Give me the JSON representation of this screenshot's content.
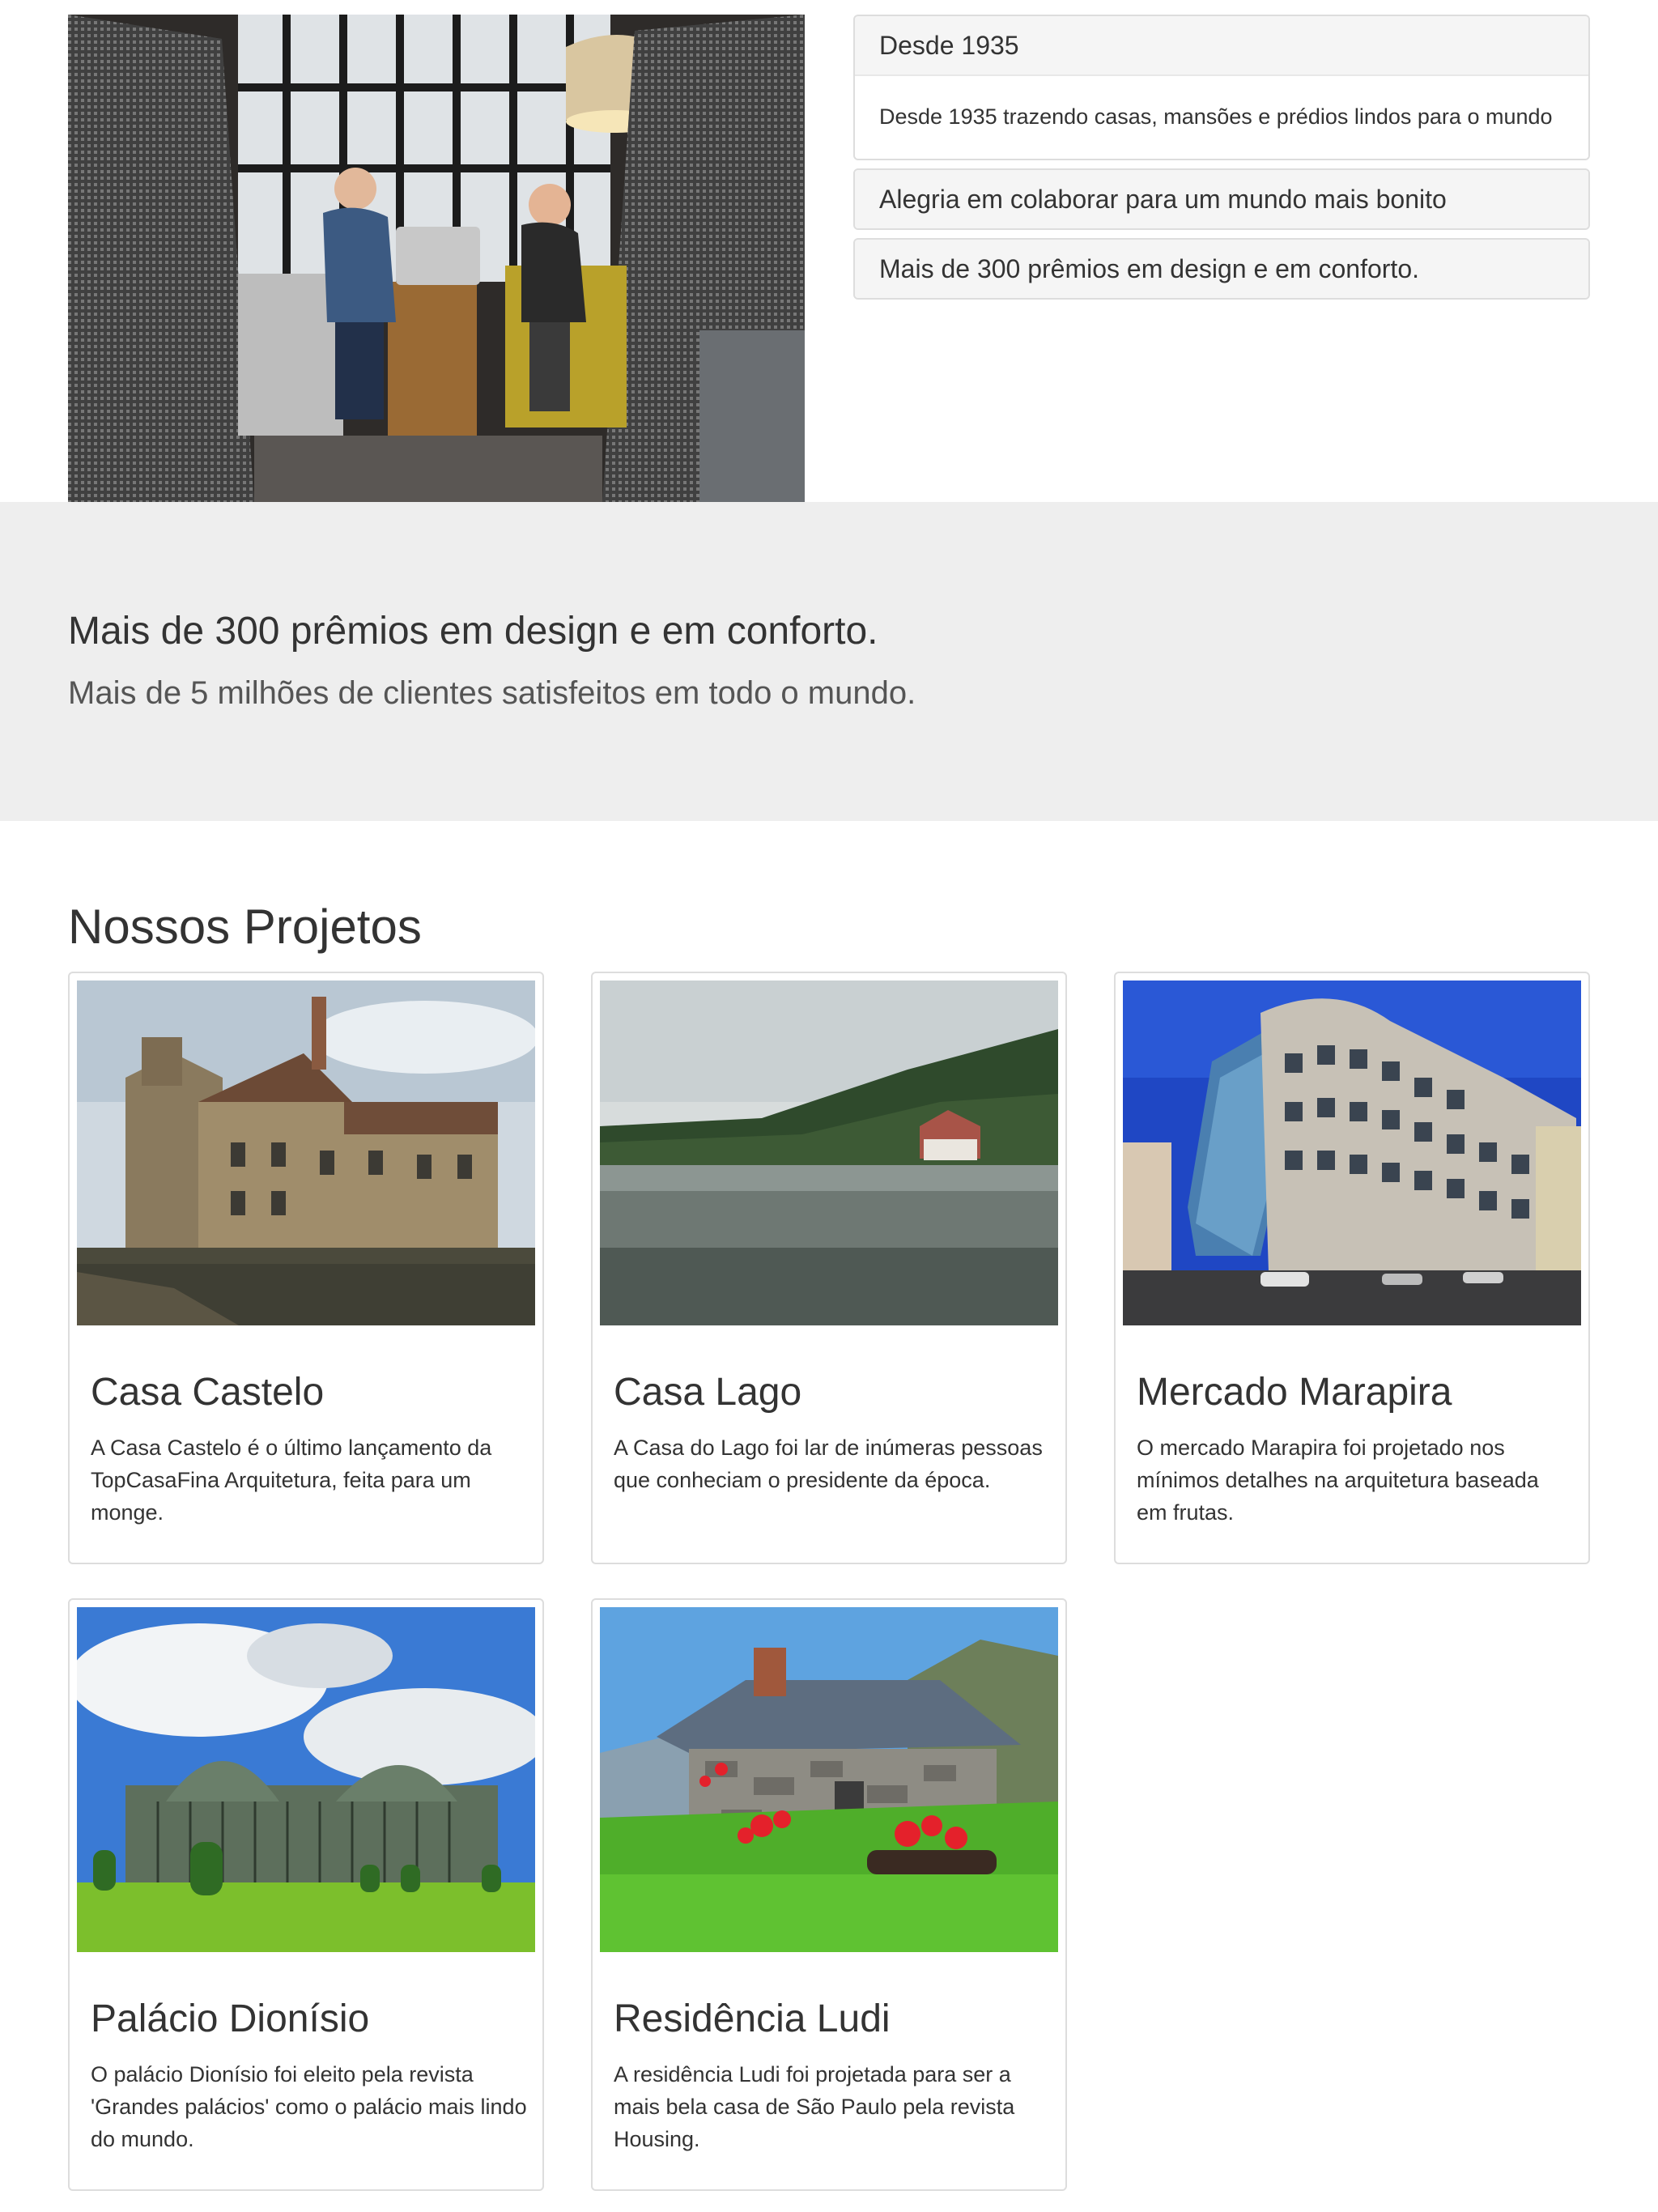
{
  "hero": {
    "image_alt": "Duas pessoas trabalhando em um notebook em uma sala de reunião"
  },
  "accordion": {
    "panels": [
      {
        "heading": "Desde 1935",
        "body": "Desde 1935 trazendo casas, mansões e prédios lindos para o mundo",
        "expanded": true
      },
      {
        "heading": "Alegria em colaborar para um mundo mais bonito",
        "expanded": false
      },
      {
        "heading": "Mais de 300 prêmios em design e em conforto.",
        "expanded": false
      }
    ]
  },
  "band": {
    "title": "Mais de 300 prêmios em design e em conforto.",
    "subtitle": "Mais de 5 milhões de clientes satisfeitos em todo o mundo."
  },
  "projects": {
    "title": "Nossos Projetos",
    "items": [
      {
        "title": "Casa Castelo",
        "text": "A Casa Castelo é o último lançamento da TopCasaFina Arquitetura, feita para um monge.",
        "image": "castle-manor-photo"
      },
      {
        "title": "Casa Lago",
        "text": "A Casa do Lago foi lar de inúmeras pessoas que conheciam o presidente da época.",
        "image": "lake-house-photo"
      },
      {
        "title": "Mercado Marapira",
        "text": "O mercado Marapira foi projetado nos mínimos detalhes na arquitetura baseada em frutas.",
        "image": "dancing-building-photo"
      },
      {
        "title": "Palácio Dionísio",
        "text": "O palácio Dionísio foi eleito pela revista 'Grandes palácios' como o palácio mais lindo do mundo.",
        "image": "glass-palace-photo"
      },
      {
        "title": "Residência Ludi",
        "text": "A residência Ludi foi projetada para ser a mais bela casa de São Paulo pela revista Housing.",
        "image": "stone-cottage-photo"
      }
    ]
  }
}
